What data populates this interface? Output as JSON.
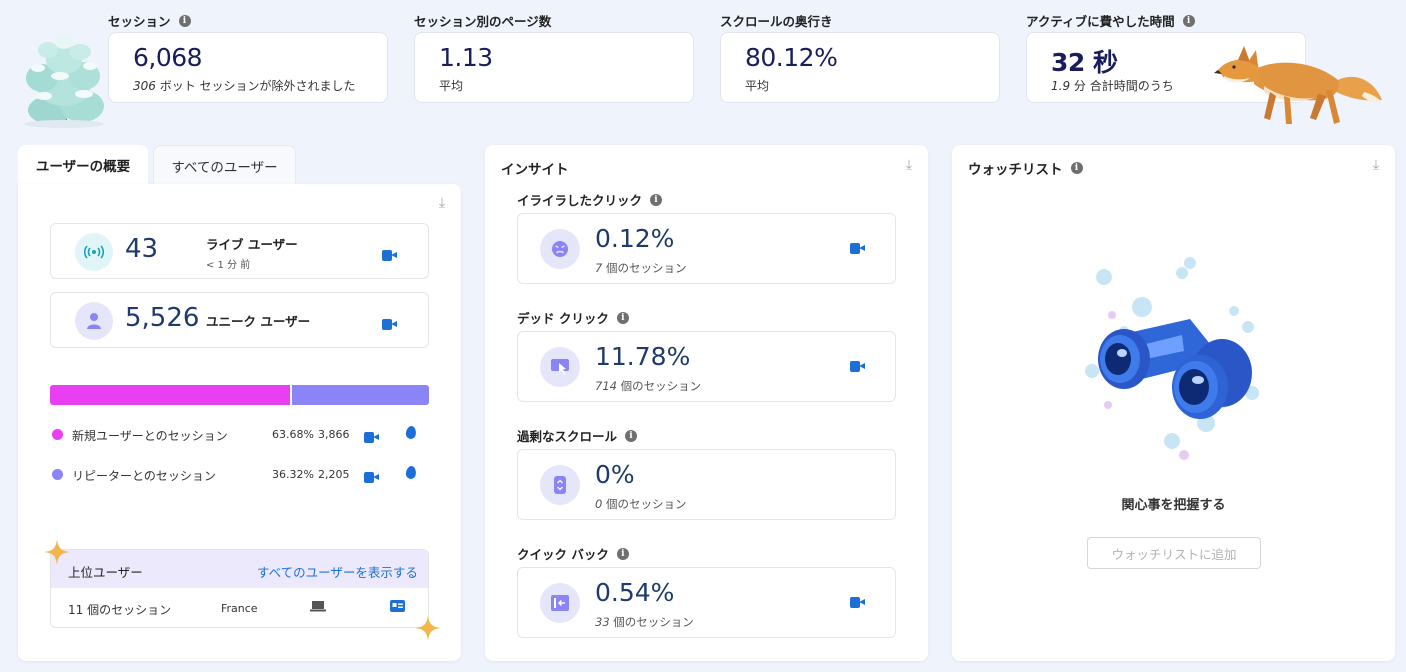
{
  "metrics": [
    {
      "label": "セッション",
      "value": "6,068",
      "sub_num": "306",
      "sub_text": " ボット セッションが除外されました",
      "info": true
    },
    {
      "label": "セッション別のページ数",
      "value": "1.13",
      "sub_num": "",
      "sub_text": "平均",
      "info": false
    },
    {
      "label": "スクロールの奥行き",
      "value": "80.12%",
      "sub_num": "",
      "sub_text": "平均",
      "info": false
    },
    {
      "label": "アクティブに費やした時間",
      "value": "32 秒",
      "sub_num": "1.9",
      "sub_text": " 分 合計時間のうち",
      "info": true
    }
  ],
  "users": {
    "tabs": [
      "ユーザーの概要",
      "すべてのユーザー"
    ],
    "live": {
      "value": "43",
      "label": "ライブ ユーザー",
      "sub": "< 1 分 前"
    },
    "unique": {
      "value": "5,526",
      "label": "ユニーク ユーザー"
    },
    "split": {
      "new_fraction": 0.6368
    },
    "legend": [
      {
        "label": "新規ユーザーとのセッション",
        "pct": "63.68%",
        "count": "3,866",
        "color": "#e83ff0"
      },
      {
        "label": "リピーターとのセッション",
        "pct": "36.32%",
        "count": "2,205",
        "color": "#8b84f7"
      }
    ],
    "top": {
      "title": "上位ユーザー",
      "link": "すべてのユーザーを表示する",
      "row_sessions": "11 個のセッション",
      "row_country": "France"
    }
  },
  "insights": {
    "title": "インサイト",
    "items": [
      {
        "label": "イライラしたクリック",
        "value": "0.12%",
        "sub_num": "7",
        "sub_text": " 個のセッション",
        "icon": "angry-face-icon",
        "video": true
      },
      {
        "label": "デッド クリック",
        "value": "11.78%",
        "sub_num": "714",
        "sub_text": " 個のセッション",
        "icon": "dead-click-icon",
        "video": true
      },
      {
        "label": "過剰なスクロール",
        "value": "0%",
        "sub_num": "0",
        "sub_text": " 個のセッション",
        "icon": "scroll-icon",
        "video": false
      },
      {
        "label": "クイック バック",
        "value": "0.54%",
        "sub_num": "33",
        "sub_text": " 個のセッション",
        "icon": "quick-back-icon",
        "video": true
      }
    ]
  },
  "watchlist": {
    "title": "ウォッチリスト",
    "empty_title": "関心事を把握する",
    "button": "ウォッチリストに追加"
  },
  "colors": {
    "new": "#e83ff0",
    "returning": "#8b84f7",
    "video": "#1d6fd8",
    "metric": "#1a1d5c"
  }
}
